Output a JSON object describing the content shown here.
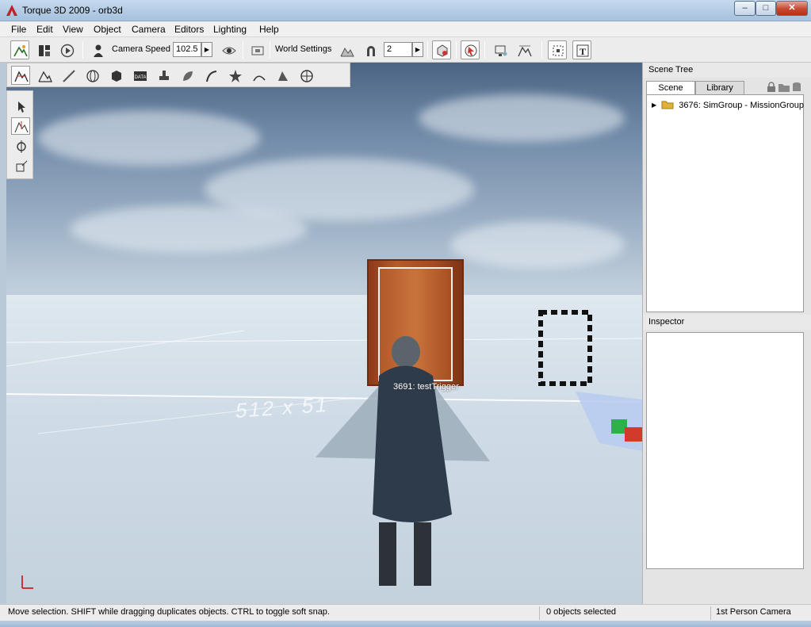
{
  "window": {
    "title": "Torque 3D 2009 - orb3d",
    "controls": {
      "minimize": "–",
      "maximize": "□",
      "close": "✕"
    }
  },
  "menu": {
    "items": [
      "File",
      "Edit",
      "View",
      "Object",
      "Camera",
      "Editors",
      "Lighting",
      "Help"
    ]
  },
  "toolbar": {
    "camera_speed_label": "Camera Speed",
    "camera_speed_value": "102.5",
    "world_settings_label": "World Settings",
    "snap_value": "2",
    "spin_glyph": "▶"
  },
  "viewport": {
    "trigger_label": "3691: testTrigger",
    "grid_label": "512 x 51"
  },
  "scene_tree": {
    "title": "Scene Tree",
    "tabs": [
      "Scene",
      "Library"
    ],
    "root_item": "3676: SimGroup - MissionGroup"
  },
  "inspector": {
    "title": "Inspector"
  },
  "status": {
    "hint": "Move selection.  SHIFT while dragging duplicates objects.  CTRL to toggle soft snap.",
    "selection": "0 objects selected",
    "camera": "1st Person Camera"
  },
  "colors": {
    "accent": "#b8301a",
    "door": "#a54a22",
    "sky": "#9db1c6"
  }
}
